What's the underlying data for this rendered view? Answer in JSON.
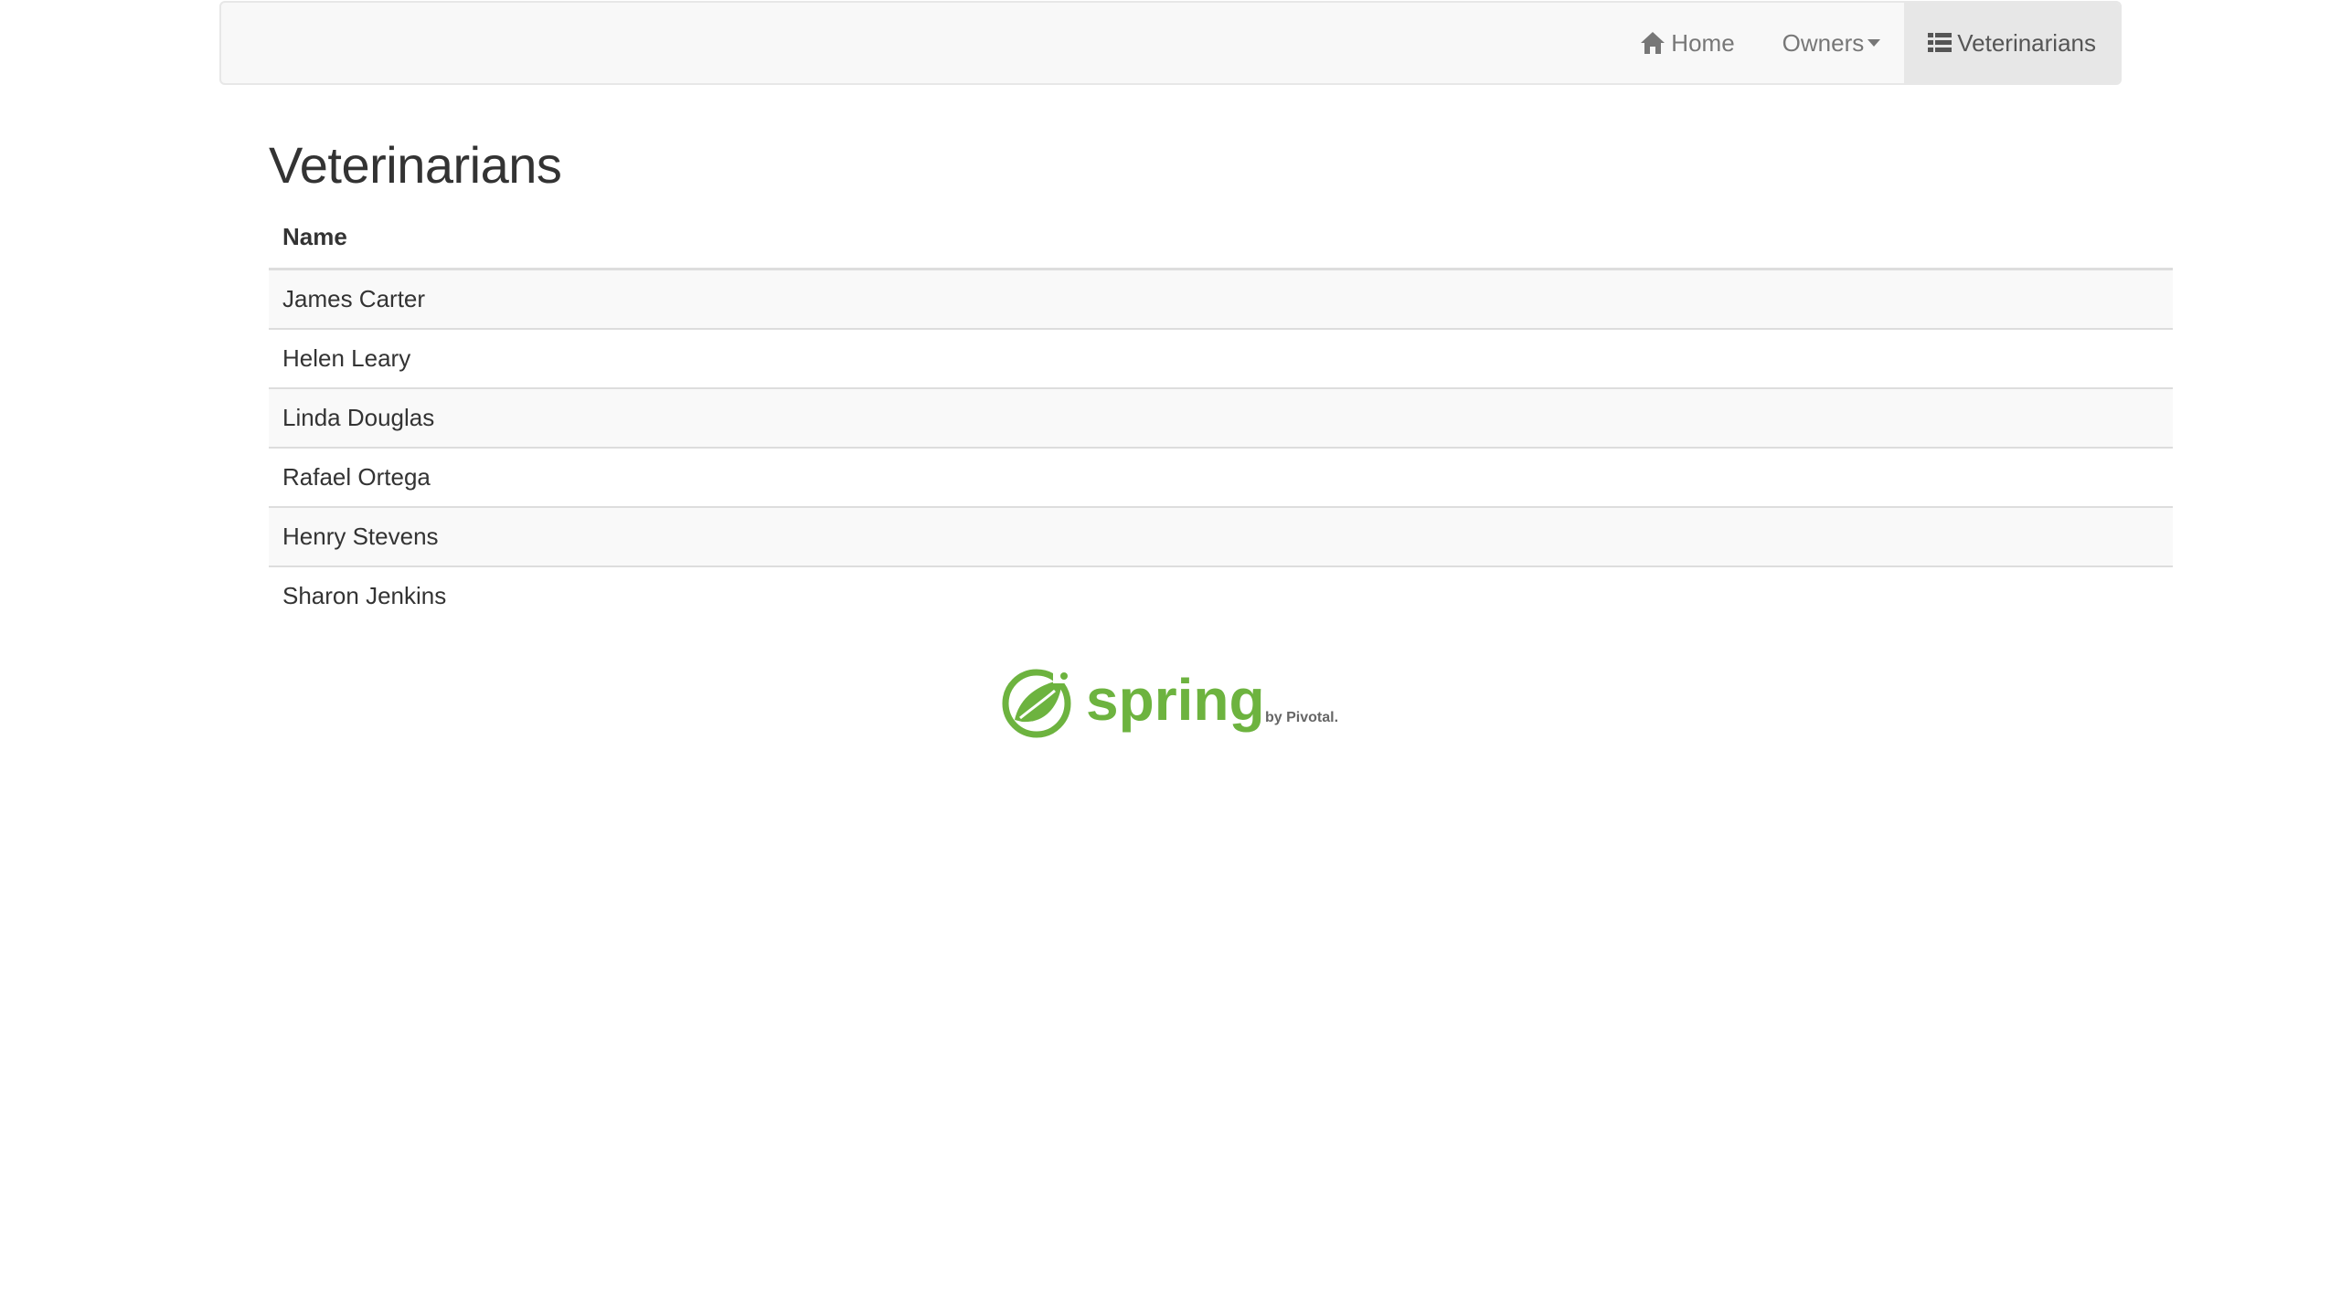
{
  "nav": {
    "home_label": "Home",
    "owners_label": "Owners",
    "vets_label": "Veterinarians",
    "home_icon": "home-icon",
    "vets_icon": "list-icon"
  },
  "main": {
    "title": "Veterinarians",
    "table": {
      "columns": [
        "Name"
      ],
      "rows": [
        "James Carter",
        "Helen Leary",
        "Linda Douglas",
        "Rafael Ortega",
        "Henry Stevens",
        "Sharon Jenkins"
      ]
    }
  },
  "footer": {
    "logo_text": "spring",
    "logo_sub": "by Pivotal."
  },
  "colors": {
    "brand_green": "#6db33f",
    "navbar_bg": "#f8f8f8",
    "active_bg": "#e7e7e7"
  }
}
